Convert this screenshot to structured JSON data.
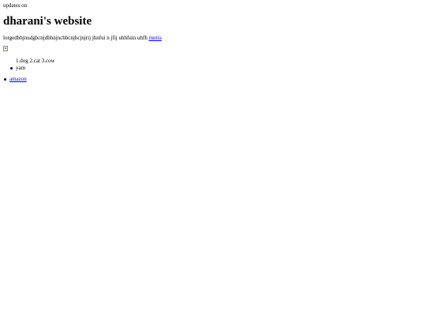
{
  "header": {
    "updates_text": "updates on"
  },
  "main": {
    "title": "dharani's website",
    "paragraph_text": "lorgedbhjnudgbcnjdbhnjnchbcnjhcjnjrij jhnfui n jfij uhhfuin uhfh",
    "paragraph_link": "mntra",
    "image_icon": "broken-image-icon",
    "pets_text": "1.dog 2.cat 3.cow",
    "inner_list": [
      "yam"
    ],
    "outer_list_link": "amazon"
  }
}
